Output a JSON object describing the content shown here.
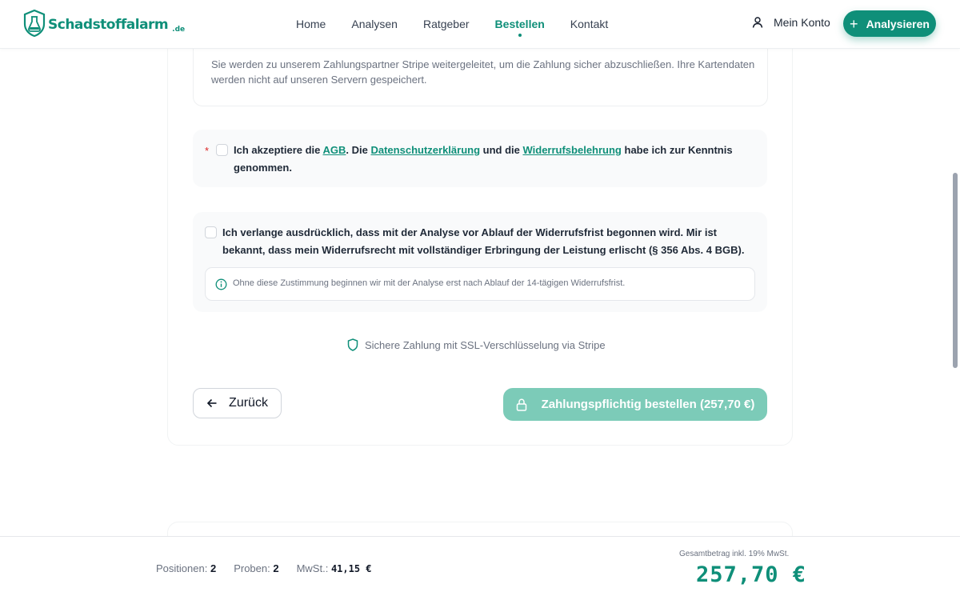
{
  "header": {
    "logo_text": "Schadstoffalarm",
    "logo_tld": ".de",
    "nav": [
      "Home",
      "Analysen",
      "Ratgeber",
      "Bestellen",
      "Kontakt"
    ],
    "active_nav": "Bestellen",
    "account_label": "Mein Konto",
    "cta_label": "Analysieren"
  },
  "payment": {
    "stripe_note": "Sie werden zu unserem Zahlungspartner Stripe weitergeleitet, um die Zahlung sicher abzuschließen. Ihre Kartendaten werden nicht auf unseren Servern gespeichert."
  },
  "consents": {
    "terms": {
      "required_mark": "*",
      "text_1": "Ich akzeptiere die ",
      "link_agb": "AGB",
      "text_2": ". Die ",
      "link_privacy": "Datenschutzerklärung",
      "text_3": " und die ",
      "link_withdrawal": "Widerrufsbelehrung",
      "text_4": " habe ich zur Kenntnis genommen."
    },
    "early_start": {
      "text": "Ich verlange ausdrücklich, dass mit der Analyse vor Ablauf der Widerrufsfrist begonnen wird. Mir ist bekannt, dass mein Widerrufsrecht mit vollständiger Erbringung der Leistung erlischt (§ 356 Abs. 4 BGB).",
      "info": "Ohne diese Zustimmung beginnen wir mit der Analyse erst nach Ablauf der 14-tägigen Widerrufsfrist."
    }
  },
  "secure_note": "Sichere Zahlung mit SSL-Verschlüsselung via Stripe",
  "buttons": {
    "back": "Zurück",
    "order": "Zahlungspflichtig bestellen (257,70 €)"
  },
  "summary": {
    "positions_label": "Positionen:",
    "positions_value": "2",
    "samples_label": "Proben:",
    "samples_value": "2",
    "vat_label": "MwSt.:",
    "vat_value": "41,15 €",
    "total_label": "Gesamtbetrag inkl. 19% MwSt.",
    "total_value": "257,70 €"
  },
  "colors": {
    "brand": "#0f8f79",
    "order_disabled": "#7ccbb8",
    "required": "#dc2626"
  }
}
